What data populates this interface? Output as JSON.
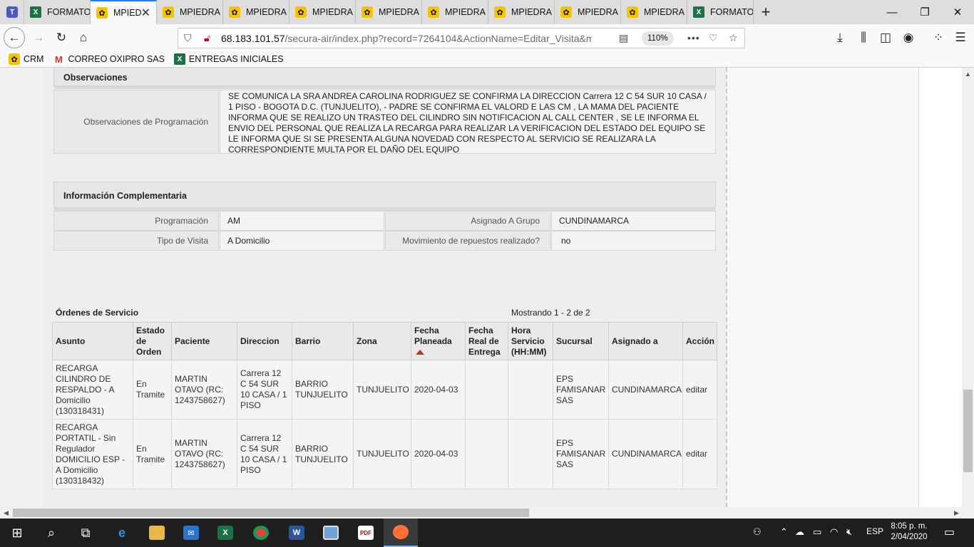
{
  "browser": {
    "tabs": [
      {
        "label": "",
        "icon": "teams-icon"
      },
      {
        "label": "FORMATO",
        "icon": "excel-icon"
      },
      {
        "label": "MPIEDRA",
        "icon": "suitecrm-icon",
        "active": true
      },
      {
        "label": "MPIEDRA",
        "icon": "suitecrm-icon"
      },
      {
        "label": "MPIEDRA",
        "icon": "suitecrm-icon"
      },
      {
        "label": "MPIEDRA",
        "icon": "suitecrm-icon"
      },
      {
        "label": "MPIEDRA",
        "icon": "suitecrm-icon"
      },
      {
        "label": "MPIEDRA",
        "icon": "suitecrm-icon"
      },
      {
        "label": "MPIEDRA",
        "icon": "suitecrm-icon"
      },
      {
        "label": "MPIEDRA",
        "icon": "suitecrm-icon"
      },
      {
        "label": "MPIEDRA",
        "icon": "suitecrm-icon"
      },
      {
        "label": "FORMATO",
        "icon": "excel-icon"
      }
    ],
    "url_host": "68.183.101.57",
    "url_path": "/secura-air/index.php?record=7264104&ActionName=Editar_Visita&m",
    "zoom": "110%",
    "bookmarks": [
      {
        "label": "CRM",
        "icon": "suitecrm-icon"
      },
      {
        "label": "CORREO OXIPRO SAS",
        "icon": "gmail-icon"
      },
      {
        "label": "ENTREGAS INICIALES",
        "icon": "excel-icon"
      }
    ]
  },
  "observaciones": {
    "title": "Observaciones",
    "label": "Observaciones de Programación",
    "text": "SE COMUNICA LA SRA ANDREA CAROLINA RODRIGUEZ SE CONFIRMA LA DIRECCION Carrera 12 C 54 SUR 10 CASA / 1 PISO - BOGOTA D.C. (TUNJUELITO), - PADRE SE CONFIRMA EL VALORD E LAS CM , LA MAMA DEL PACIENTE INFORMA QUE SE REALIZO UN TRASTEO DEL CILINDRO SIN NOTIFICACION AL CALL CENTER , SE LE INFORMA EL ENVIO DEL PERSONAL QUE REALIZA LA RECARGA PARA REALIZAR LA VERIFICACION DEL ESTADO DEL EQUIPO SE LE INFORMA QUE SI SE PRESENTA ALGUNA NOVEDAD CON RESPECTO AL SERVICIO SE REALIZARA LA CORRESPONDIENTE MULTA POR EL DAÑO DEL EQUIPO"
  },
  "info": {
    "title": "Información Complementaria",
    "programacion_label": "Programación",
    "programacion_value": "AM",
    "grupo_label": "Asignado A Grupo",
    "grupo_value": "CUNDINAMARCA",
    "tipo_label": "Tipo de Visita",
    "tipo_value": "A Domicilio",
    "movimiento_label": "Movimiento de repuestos realizado?",
    "movimiento_value": "no"
  },
  "orders": {
    "title": "Órdenes de Servicio",
    "count_text": "Mostrando 1 - 2 de 2",
    "headers": [
      "Asunto",
      "Estado de Orden",
      "Paciente",
      "Direccion",
      "Barrio",
      "Zona",
      "Fecha Planeada",
      "Fecha Real de Entrega",
      "Hora Servicio (HH:MM)",
      "Sucursal",
      "Asignado a",
      "Acción"
    ],
    "rows": [
      {
        "asunto": "RECARGA CILINDRO DE RESPALDO - A Domicilio (130318431)",
        "estado": "En Tramite",
        "paciente": "MARTIN OTAVO (RC: 1243758627)",
        "direccion": "Carrera 12 C 54 SUR 10 CASA / 1 PISO",
        "barrio": "BARRIO TUNJUELITO",
        "zona": "TUNJUELITO",
        "fecha_planeada": "2020-04-03",
        "fecha_real": "",
        "hora": "",
        "sucursal": "EPS FAMISANAR SAS",
        "asignado": "CUNDINAMARCA",
        "accion": "editar"
      },
      {
        "asunto": "RECARGA PORTATIL - Sin Regulador DOMICILIO ESP - A Domicilio (130318432)",
        "estado": "En Tramite",
        "paciente": "MARTIN OTAVO (RC: 1243758627)",
        "direccion": "Carrera 12 C 54 SUR 10 CASA / 1 PISO",
        "barrio": "BARRIO TUNJUELITO",
        "zona": "TUNJUELITO",
        "fecha_planeada": "2020-04-03",
        "fecha_real": "",
        "hora": "",
        "sucursal": "EPS FAMISANAR SAS",
        "asignado": "CUNDINAMARCA",
        "accion": "editar"
      }
    ]
  },
  "taskbar": {
    "language": "ESP",
    "time": "8:05 p. m.",
    "date": "2/04/2020"
  }
}
